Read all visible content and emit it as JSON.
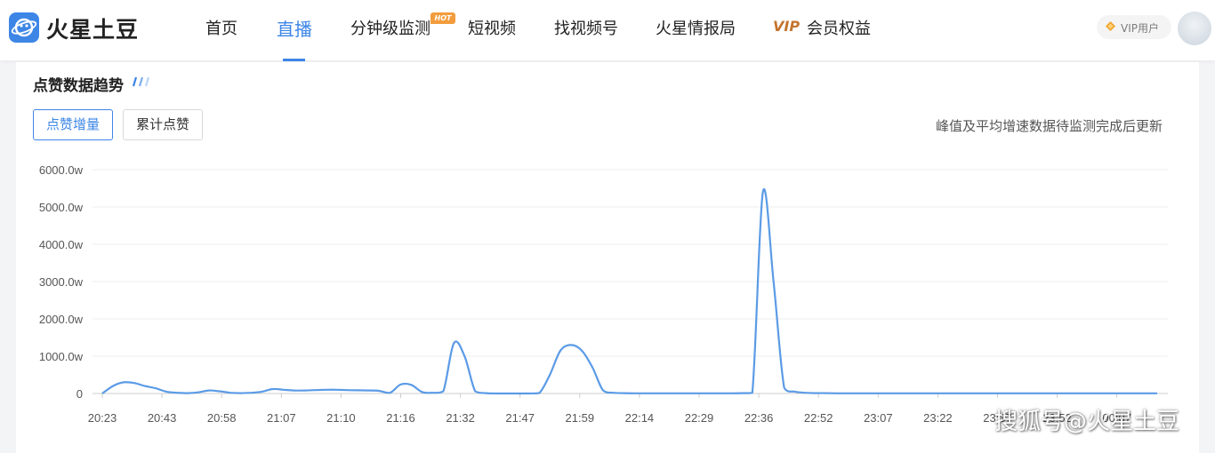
{
  "header": {
    "app_name": "火星土豆",
    "nav": [
      "首页",
      "直播",
      "分钟级监测",
      "短视频",
      "找视频号",
      "火星情报局",
      "会员权益"
    ],
    "active_nav": "直播",
    "hot_badge": "HOT",
    "vip_mark": "VIP",
    "vip_user_label": "VIP用户"
  },
  "section": {
    "title": "点赞数据趋势",
    "buttons": [
      "点赞增量",
      "累计点赞"
    ],
    "active_button": "点赞增量",
    "note": "峰值及平均增速数据待监测完成后更新"
  },
  "watermark": "搜狐号@火星土豆",
  "colors": {
    "accent": "#3d86e6",
    "line": "#5b9be6",
    "badge": "#f39c3d",
    "vip": "#c4742e"
  },
  "chart_data": {
    "type": "line",
    "title": "",
    "xlabel": "",
    "ylabel": "",
    "ylim": [
      0,
      6000
    ],
    "y_ticks": [
      "0",
      "1000.0w",
      "2000.0w",
      "3000.0w",
      "4000.0w",
      "5000.0w",
      "6000.0w"
    ],
    "categories": [
      "20:23",
      "20:43",
      "20:58",
      "21:07",
      "21:10",
      "21:16",
      "21:32",
      "21:47",
      "21:59",
      "22:14",
      "22:29",
      "22:36",
      "22:52",
      "23:07",
      "23:22",
      "23:37",
      "23:52",
      "00:07"
    ],
    "grid": true,
    "series": [
      {
        "values": [
          0,
          200,
          300,
          280,
          200,
          140,
          50,
          20,
          10,
          30,
          80,
          60,
          20,
          10,
          20,
          50,
          120,
          100,
          80,
          80,
          90,
          100,
          100,
          90,
          85,
          80,
          70,
          20,
          240,
          230,
          40,
          20,
          60,
          1350,
          1000,
          60,
          10,
          0,
          0,
          0,
          0,
          10,
          500,
          1150,
          1300,
          1150,
          700,
          80,
          20,
          10,
          5,
          5,
          5,
          5,
          5,
          5,
          5,
          5,
          5,
          5,
          10,
          20,
          5400,
          3000,
          150,
          50,
          20,
          10,
          10,
          5,
          5,
          5,
          5,
          5,
          5,
          5,
          5,
          5,
          5,
          5,
          5,
          5,
          5,
          5,
          5,
          5,
          5,
          5,
          5,
          5,
          5,
          5,
          5,
          5,
          5,
          5,
          5,
          5,
          5,
          5
        ]
      }
    ]
  }
}
